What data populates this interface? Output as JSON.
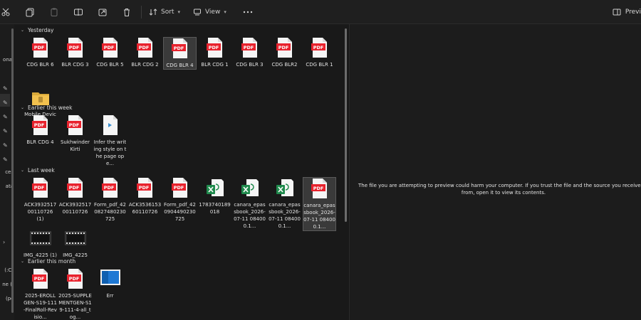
{
  "toolbar": {
    "sort_label": "Sort",
    "view_label": "View",
    "preview_label": "Previ"
  },
  "nav": {
    "items": [
      {
        "label": "onal"
      },
      {
        "label": "ces"
      },
      {
        "label": "ata"
      },
      {
        "label": "(C:)"
      },
      {
        "label": "ne (I"
      },
      {
        "label": "pc)"
      }
    ]
  },
  "groups": {
    "yesterday": "Yesterday",
    "earlier_week": "Earlier this week",
    "last_week": "Last week",
    "earlier_month": "Earlier this month"
  },
  "files": {
    "yesterday": [
      {
        "label": "CDG BLR 6",
        "type": "pdf"
      },
      {
        "label": "BLR CDG 3",
        "type": "pdf"
      },
      {
        "label": "CDG BLR 5",
        "type": "pdf"
      },
      {
        "label": "BLR CDG 2",
        "type": "pdf"
      },
      {
        "label": "CDG BLR 4",
        "type": "pdf"
      },
      {
        "label": "BLR CDG 1",
        "type": "pdf"
      },
      {
        "label": "CDG BLR 3",
        "type": "pdf"
      },
      {
        "label": "CDG BLR2",
        "type": "pdf"
      },
      {
        "label": "CDG BLR 1",
        "type": "pdf"
      },
      {
        "label": "Mobile Devices",
        "type": "folder"
      }
    ],
    "earlier_week": [
      {
        "label": "BLR CDG 4",
        "type": "pdf"
      },
      {
        "label": "Sukhwinder Kirti",
        "type": "pdf"
      },
      {
        "label": "Infer the writing style on the page ope...",
        "type": "doc"
      }
    ],
    "last_week": [
      {
        "label": "ACK393251700110726 (1)",
        "type": "pdf"
      },
      {
        "label": "ACK393251700110726",
        "type": "pdf"
      },
      {
        "label": "Form_pdf_420827480230725",
        "type": "pdf"
      },
      {
        "label": "ACK353615360110726",
        "type": "pdf"
      },
      {
        "label": "Form_pdf_420904490230725",
        "type": "pdf"
      },
      {
        "label": "1783740189018",
        "type": "excel"
      },
      {
        "label": "canara_epassbook_2026-07-11 084000.1...",
        "type": "excel"
      },
      {
        "label": "canara_epassbook_2026-07-11 084000.1...",
        "type": "excel"
      },
      {
        "label": "canara_epassbook_2026-07-11 084000.1...",
        "type": "pdf"
      },
      {
        "label": "IMG_4225 (1)",
        "type": "video"
      },
      {
        "label": "IMG_4225",
        "type": "video"
      }
    ],
    "earlier_month": [
      {
        "label": "2025-EROLLGEN-S19-111-FinalRoll-Revisio...",
        "type": "pdf"
      },
      {
        "label": "2025-SUPPLEMENTGEN-S19-111-4-all_tog...",
        "type": "pdf"
      },
      {
        "label": "Err",
        "type": "blue"
      }
    ]
  },
  "icon_text": {
    "pdf": "PDF"
  },
  "preview": {
    "message": "The file you are attempting to preview could harm your computer. If you trust the file and the source you received it from, open it to view its contents."
  },
  "colors": {
    "pdf_red": "#e8222d",
    "excel_green": "#1f8a4c",
    "folder_yellow": "#f2c14e",
    "selection": "#3a3a3a"
  }
}
